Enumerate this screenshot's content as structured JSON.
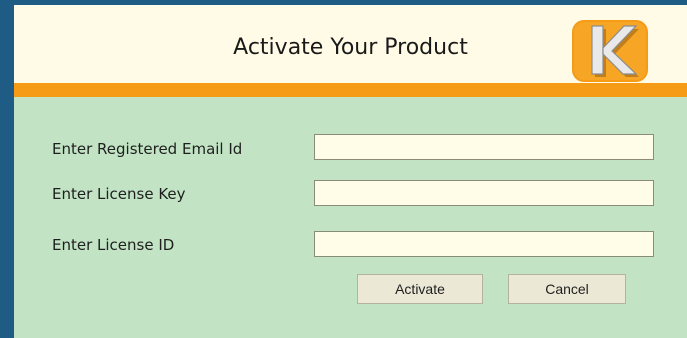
{
  "header": {
    "title": "Activate Your Product",
    "logo_letter": "K"
  },
  "form": {
    "email_label": "Enter Registered Email Id",
    "email_value": "",
    "license_key_label": "Enter License Key",
    "license_key_value": "",
    "license_id_label": "Enter License ID",
    "license_id_value": ""
  },
  "buttons": {
    "activate_label": "Activate",
    "cancel_label": "Cancel"
  },
  "colors": {
    "background": "#c2e4c4",
    "header_bg": "#fffbe6",
    "accent_orange": "#f59b16",
    "frame_blue": "#1e5c86"
  }
}
